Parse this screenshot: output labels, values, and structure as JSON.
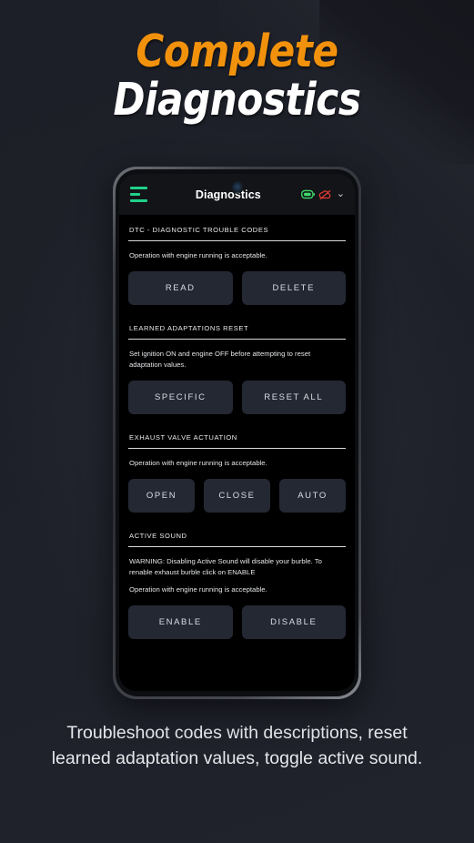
{
  "headline": {
    "line1": "Complete",
    "line2": "Diagnostics",
    "accent_color": "#f2920c",
    "line2_color": "#ffffff"
  },
  "phone": {
    "app_header": {
      "menu_icon": "hamburger-menu-icon",
      "title": "Diagnostics",
      "status_icons": [
        {
          "name": "battery-icon",
          "color": "#3ddb6a"
        },
        {
          "name": "cloud-off-icon",
          "color": "#e23b30"
        }
      ],
      "chevron": "⌄"
    },
    "sections": [
      {
        "title": "DTC - DIAGNOSTIC TROUBLE CODES",
        "descriptions": [
          "Operation with engine running is acceptable."
        ],
        "buttons": [
          "READ",
          "DELETE"
        ]
      },
      {
        "title": "LEARNED ADAPTATIONS RESET",
        "descriptions": [
          "Set ignition ON and engine OFF before attempting to reset adaptation values."
        ],
        "buttons": [
          "SPECIFIC",
          "RESET ALL"
        ]
      },
      {
        "title": "EXHAUST VALVE ACTUATION",
        "descriptions": [
          "Operation with engine running is acceptable."
        ],
        "buttons": [
          "OPEN",
          "CLOSE",
          "AUTO"
        ]
      },
      {
        "title": "ACTIVE SOUND",
        "descriptions": [
          "WARNING: Disabling Active Sound will disable your burble. To renable exhaust burble click on ENABLE",
          "Operation with engine running is acceptable."
        ],
        "buttons": [
          "ENABLE",
          "DISABLE"
        ]
      }
    ]
  },
  "caption": "Troubleshoot codes with descriptions, reset learned adaptation values, toggle active sound.",
  "theme": {
    "background": "#1e2029",
    "screen_background": "#000000",
    "header_background": "#131418",
    "button_background": "#242833",
    "accent_green": "#1fd18a"
  }
}
